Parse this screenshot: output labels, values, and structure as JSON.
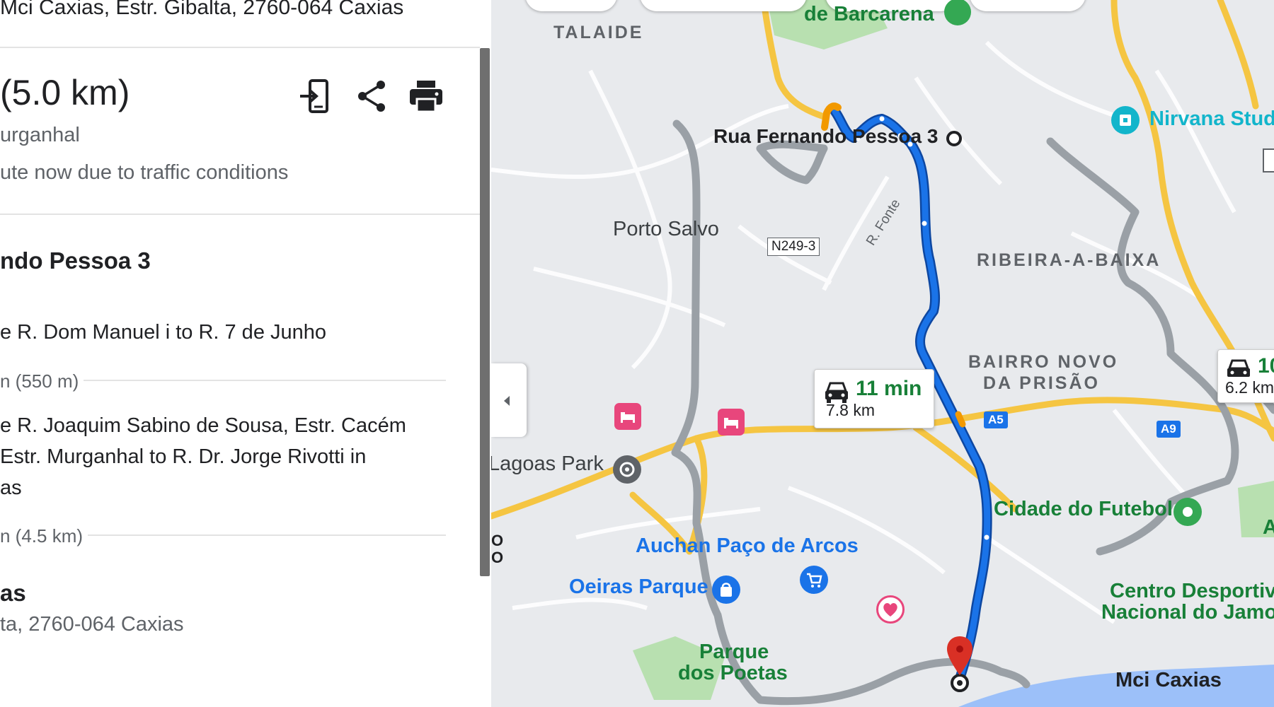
{
  "panel": {
    "header_address": "Mci Caxias, Estr. Gibalta, 2760-064 Caxias",
    "summary": {
      "distance": "(5.0 km)",
      "via": "urganhal",
      "traffic_note": "ute now due to traffic conditions"
    },
    "origin_title": "ndo Pessoa 3",
    "steps": [
      {
        "text": "e R. Dom Manuel i to R. 7 de Junho",
        "sub": "n (550 m)"
      },
      {
        "lines": [
          "e R. Joaquim Sabino de Sousa, Estr. Cacém",
          "Estr. Murganhal to R. Dr. Jorge Rivotti in",
          "as"
        ],
        "sub": "n (4.5 km)"
      }
    ],
    "destination": {
      "title": "as",
      "address": "ta, 2760-064 Caxias"
    },
    "icons": [
      "send-to-phone-icon",
      "share-icon",
      "print-icon"
    ]
  },
  "map": {
    "labels": {
      "talaide": "TALAIDE",
      "barcarena": "de Barcarena",
      "origin": "Rua Fernando Pessoa 3",
      "nirvana": "Nirvana Stud",
      "porto_salvo": "Porto Salvo",
      "road_n249": "N249-3",
      "r_fonte": "R. Fonte",
      "ribeira": "RIBEIRA-A-BAIXA",
      "bairro1": "BAIRRO NOVO",
      "bairro2": "DA PRISÃO",
      "lagoas": "Lagoas Park",
      "futebol": "Cidade do Futebol",
      "auchan": "Auchan Paço de Arcos",
      "oeiras": "Oeiras Parque",
      "centro1": "Centro Desportivo",
      "centro2": "Nacional do Jamo",
      "parque1": "Parque",
      "parque2": "dos Poetas",
      "destination": "Mci Caxias",
      "a5": "A5",
      "a9": "A9",
      "edge_letter_a": "A",
      "edge_o1": "O",
      "edge_o2": "O"
    },
    "routes": {
      "main": {
        "time": "11 min",
        "distance": "7.8 km"
      },
      "alt": {
        "time": "10",
        "distance": "6.2 km"
      }
    },
    "colors": {
      "route_blue": "#1a73e8",
      "route_grey": "#9aa0a6",
      "highway": "#f5c542",
      "park": "#b8e0b0",
      "water": "#9cc0f9",
      "traffic_orange": "#f29900",
      "poi_pink": "#e8467c",
      "time_green": "#188038"
    }
  }
}
